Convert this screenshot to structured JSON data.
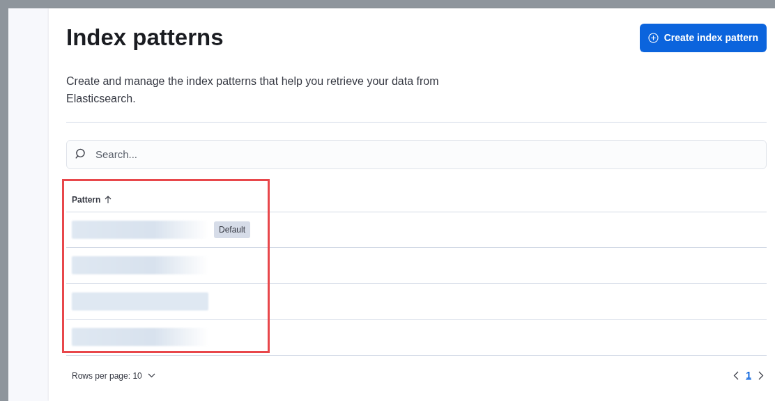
{
  "page": {
    "title": "Index patterns",
    "description": "Create and manage the index patterns that help you retrieve your data from Elasticsearch."
  },
  "create_button": {
    "label": "Create index pattern"
  },
  "search": {
    "placeholder": "Search..."
  },
  "table": {
    "columns": [
      {
        "label": "Pattern",
        "sort_ascending": true
      }
    ],
    "rows": [
      {
        "badge": "Default"
      },
      {},
      {},
      {}
    ]
  },
  "footer": {
    "rows_per_page": "Rows per page: 10",
    "pages": [
      {
        "label": "1",
        "selected": true
      }
    ]
  }
}
